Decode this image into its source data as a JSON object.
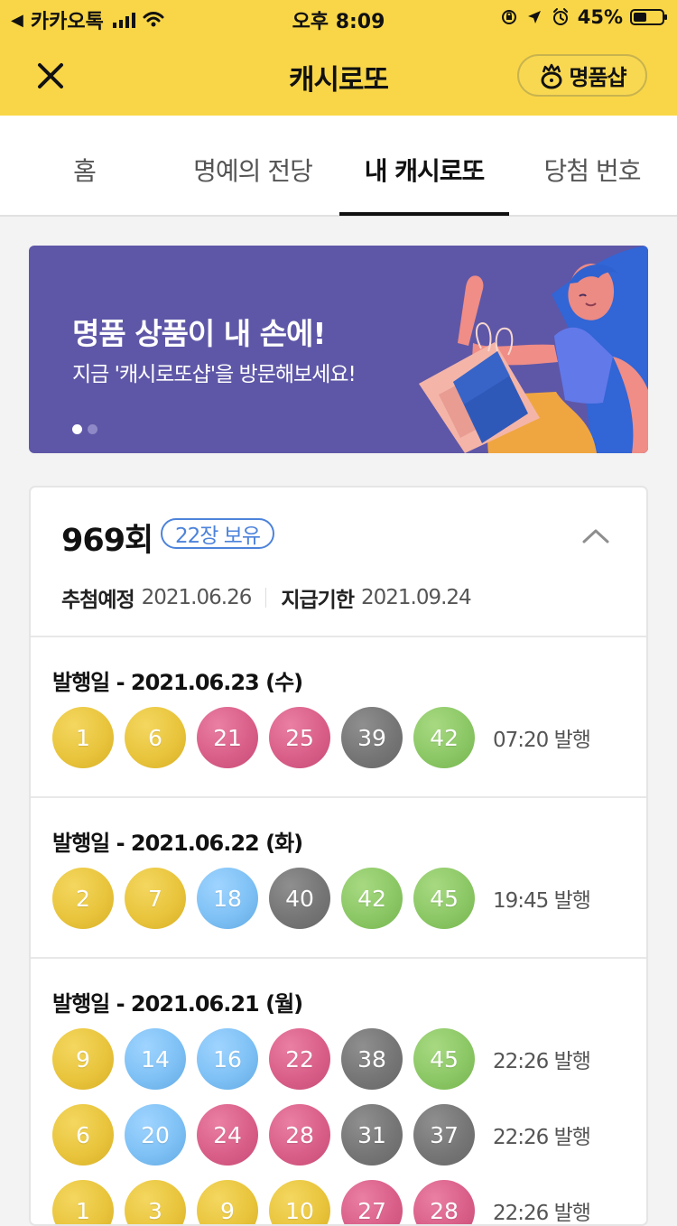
{
  "status_bar": {
    "back_label": "카카오톡",
    "time": "오후 8:09",
    "battery": "45%"
  },
  "header": {
    "title": "캐시로또",
    "shop_label": "명품샵"
  },
  "tabs": [
    {
      "label": "홈"
    },
    {
      "label": "명예의 전당"
    },
    {
      "label": "내 캐시로또",
      "active": true
    },
    {
      "label": "당첨 번호"
    }
  ],
  "banner": {
    "title": "명품 상품이 내 손에!",
    "subtitle": "지금 '캐시로또샵'을 방문해보세요!",
    "dot_count": 2,
    "active_dot": 1
  },
  "lotto_card": {
    "round": "969회",
    "badge": "22장 보유",
    "draw_label": "추첨예정",
    "draw_date": "2021.06.26",
    "deadline_label": "지급기한",
    "deadline_date": "2021.09.24"
  },
  "tickets": [
    {
      "issue_label": "발행일 - 2021.06.23 (수)",
      "rows": [
        {
          "numbers": [
            "1",
            "6",
            "21",
            "25",
            "39",
            "42"
          ],
          "colors": [
            "yellow",
            "yellow",
            "pink",
            "pink",
            "gray",
            "green"
          ],
          "time": "07:20 발행"
        }
      ]
    },
    {
      "issue_label": "발행일 - 2021.06.22 (화)",
      "rows": [
        {
          "numbers": [
            "2",
            "7",
            "18",
            "40",
            "42",
            "45"
          ],
          "colors": [
            "yellow",
            "yellow",
            "blue",
            "gray",
            "green",
            "green"
          ],
          "time": "19:45 발행"
        }
      ]
    },
    {
      "issue_label": "발행일 - 2021.06.21 (월)",
      "rows": [
        {
          "numbers": [
            "9",
            "14",
            "16",
            "22",
            "38",
            "45"
          ],
          "colors": [
            "yellow",
            "blue",
            "blue",
            "pink",
            "gray",
            "green"
          ],
          "time": "22:26 발행"
        },
        {
          "numbers": [
            "6",
            "20",
            "24",
            "28",
            "31",
            "37"
          ],
          "colors": [
            "yellow",
            "blue",
            "pink",
            "pink",
            "gray",
            "gray"
          ],
          "time": "22:26 발행"
        },
        {
          "numbers": [
            "1",
            "3",
            "9",
            "10",
            "27",
            "28"
          ],
          "colors": [
            "yellow",
            "yellow",
            "yellow",
            "yellow",
            "pink",
            "pink"
          ],
          "time": "22:26 발행"
        }
      ]
    }
  ],
  "colors": {
    "header_yellow": "#f9d648",
    "banner_purple": "#5e57a7",
    "badge_blue": "#4d83db",
    "ball_yellow": "#e9c53d",
    "ball_blue": "#7fc1f5",
    "ball_pink": "#d95f89",
    "ball_gray": "#767676",
    "ball_green": "#8cc866"
  },
  "icons": {
    "close": "close-icon",
    "shop": "crown-bag-icon",
    "collapse": "chevron-up-icon"
  }
}
